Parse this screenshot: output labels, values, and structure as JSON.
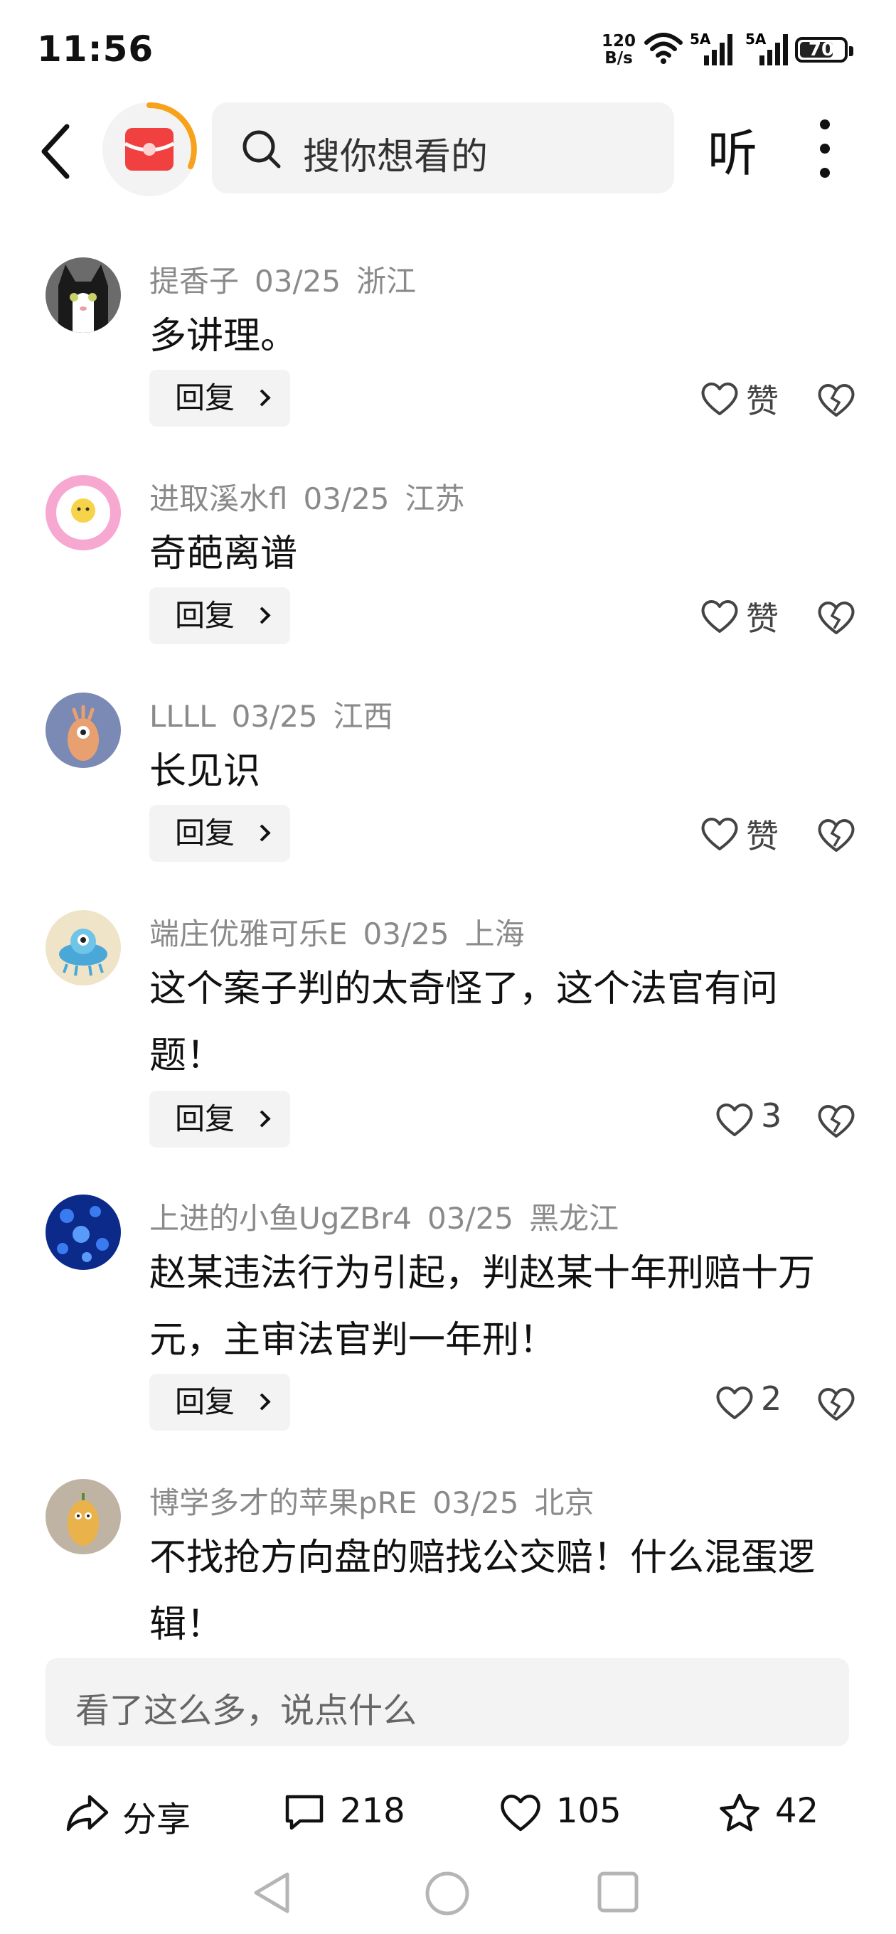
{
  "status_bar": {
    "time": "11:56",
    "net_speed_value": "120",
    "net_speed_unit": "B/s",
    "signal_1": "5A",
    "signal_2": "5A",
    "battery": "70"
  },
  "header": {
    "search_placeholder": "搜你想看的",
    "listen_label": "听",
    "icons": [
      "back-icon",
      "red-envelope-icon",
      "search-icon",
      "more-icon"
    ]
  },
  "comments": [
    {
      "user": "提香子",
      "date": "03/25",
      "location": "浙江",
      "text": "多讲理。",
      "reply_label": "回复",
      "like_label": "赞"
    },
    {
      "user": "进取溪水fl",
      "date": "03/25",
      "location": "江苏",
      "text": "奇葩离谱",
      "reply_label": "回复",
      "like_label": "赞"
    },
    {
      "user": "LLLL",
      "date": "03/25",
      "location": "江西",
      "text": "长见识",
      "reply_label": "回复",
      "like_label": "赞"
    },
    {
      "user": "端庄优雅可乐E",
      "date": "03/25",
      "location": "上海",
      "text": "这个案子判的太奇怪了，这个法官有问题！",
      "reply_label": "回复",
      "like_label": "3"
    },
    {
      "user": "上进的小鱼UgZBr4",
      "date": "03/25",
      "location": "黑龙江",
      "text": "赵某违法行为引起，判赵某十年刑赔十万元，主审法官判一年刑！",
      "reply_label": "回复",
      "like_label": "2"
    },
    {
      "user": "博学多才的苹果pRE",
      "date": "03/25",
      "location": "北京",
      "text": "不找抢方向盘的赔找公交赔！什么混蛋逻辑！"
    }
  ],
  "input": {
    "placeholder": "看了这么多，说点什么"
  },
  "actions": {
    "share": "分享",
    "comments": "218",
    "likes": "105",
    "favorites": "42"
  },
  "colors": {
    "accent_red": "#f04040",
    "accent_orange": "#f7a21b",
    "meta_gray": "#8a8a8a"
  }
}
